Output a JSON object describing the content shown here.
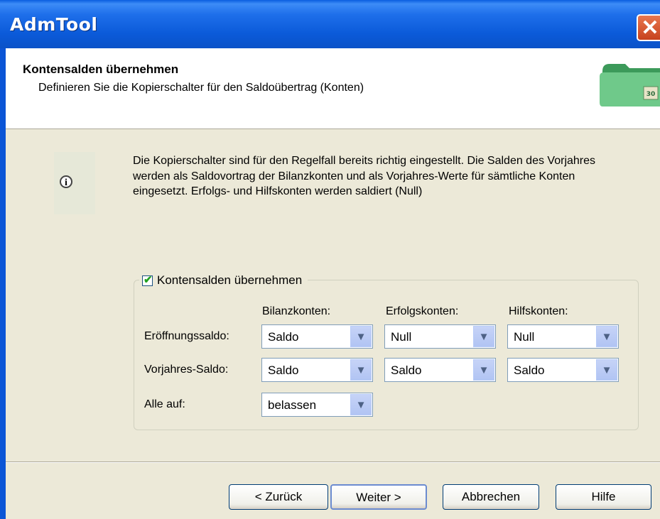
{
  "window": {
    "title": "AdmTool",
    "close_glyph": "✕"
  },
  "header": {
    "title": "Kontensalden übernehmen",
    "subtitle": "Definieren Sie die Kopierschalter für den Saldoübertrag (Konten)",
    "icon_badge": "30"
  },
  "info": {
    "text": "Die Kopierschalter sind für den Regelfall bereits richtig eingestellt. Die Salden des Vorjahres werden als Saldovortrag der Bilanzkonten und als Vorjahres-Werte für sämtliche Konten eingesetzt. Erfolgs- und Hilfskonten werden saldiert (Null)",
    "icon_glyph": "i"
  },
  "group": {
    "checkbox_label": "Kontensalden übernehmen",
    "checked": true,
    "columns": [
      "Bilanzkonten:",
      "Erfolgskonten:",
      "Hilfskonten:"
    ],
    "rows": [
      {
        "label": "Eröffnungssaldo:",
        "values": [
          "Saldo",
          "Null",
          "Null"
        ]
      },
      {
        "label": "Vorjahres-Saldo:",
        "values": [
          "Saldo",
          "Saldo",
          "Saldo"
        ]
      }
    ],
    "alle_auf": {
      "label": "Alle auf:",
      "value": "belassen"
    }
  },
  "buttons": {
    "back": "< Zurück",
    "next": "Weiter >",
    "cancel": "Abbrechen",
    "help": "Hilfe"
  },
  "colors": {
    "titlebar": "#0A5EE0",
    "dialog_bg": "#ECE9D8",
    "close": "#D2542E"
  }
}
